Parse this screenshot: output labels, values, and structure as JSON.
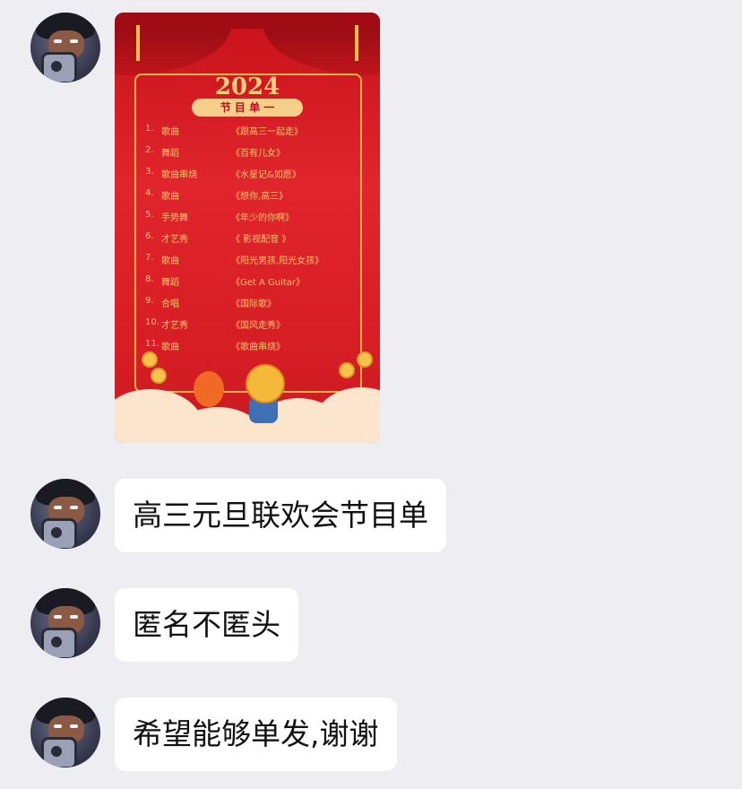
{
  "poster": {
    "year_art": "2024",
    "banner": "节 目 单 一",
    "programs": [
      {
        "num": "1.",
        "type": "歌曲",
        "title": "《跟高三一起走》"
      },
      {
        "num": "2.",
        "type": "舞蹈",
        "title": "《百有儿女》"
      },
      {
        "num": "3.",
        "type": "歌曲串烧",
        "title": "《水星记&如愿》"
      },
      {
        "num": "4.",
        "type": "歌曲",
        "title": "《想你,高三》"
      },
      {
        "num": "5.",
        "type": "手势舞",
        "title": "《年少的你啊》"
      },
      {
        "num": "6.",
        "type": "才艺秀",
        "title": "《 影视配音 》"
      },
      {
        "num": "7.",
        "type": "歌曲",
        "title": "《阳光男孩,阳光女孩》"
      },
      {
        "num": "8.",
        "type": "舞蹈",
        "title": "《Get A Guitar》"
      },
      {
        "num": "9.",
        "type": "合唱",
        "title": "《国际歌》"
      },
      {
        "num": "10.",
        "type": "才艺秀",
        "title": "《国风走秀》"
      },
      {
        "num": "11.",
        "type": "歌曲",
        "title": "《歌曲串烧》"
      }
    ]
  },
  "messages": [
    {
      "text": "高三元旦联欢会节目单"
    },
    {
      "text": "匿名不匿头"
    },
    {
      "text": "希望能够单发,谢谢"
    }
  ],
  "colors": {
    "background": "#EDEDF2",
    "bubble": "#FFFFFF",
    "poster_red": "#D81E25",
    "poster_gold": "#F4C56B"
  },
  "icons": {
    "avatar": "anime-avatar-icon"
  }
}
